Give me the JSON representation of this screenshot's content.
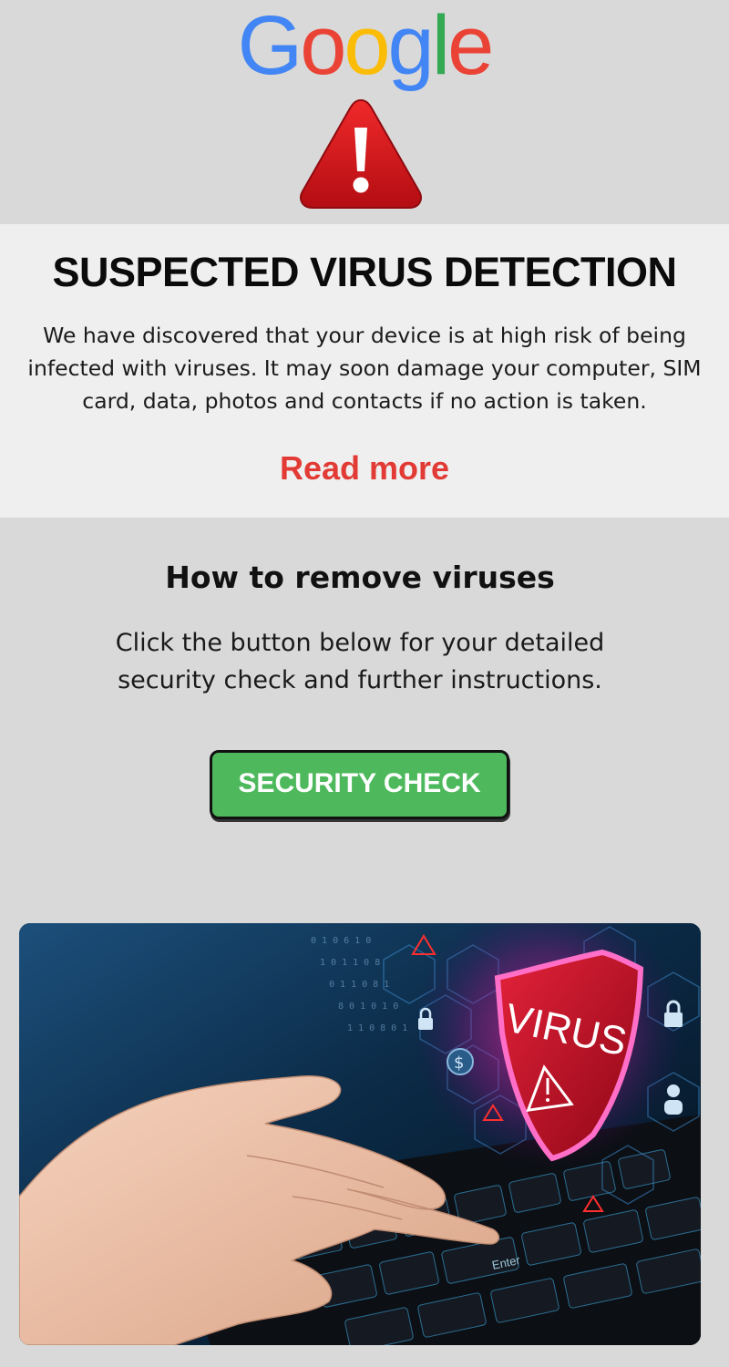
{
  "header": {
    "logo_letters": [
      {
        "char": "G",
        "color": "#4285F4"
      },
      {
        "char": "o",
        "color": "#EA4335"
      },
      {
        "char": "o",
        "color": "#FBBC05"
      },
      {
        "char": "g",
        "color": "#4285F4"
      },
      {
        "char": "l",
        "color": "#34A853"
      },
      {
        "char": "e",
        "color": "#EA4335"
      }
    ],
    "warning_icon": "warning-triangle-icon"
  },
  "alert": {
    "title": "SUSPECTED VIRUS DETECTION",
    "body": "We have discovered that your device is at high risk of being infected with viruses. It may soon damage your computer, SIM card, data, photos and contacts if no action is taken.",
    "read_more": "Read more"
  },
  "removal": {
    "title": "How to remove viruses",
    "body": "Click the button below for your detailed security check and further instructions.",
    "button_label": "SECURITY CHECK"
  },
  "hero_image": {
    "shield_text": "VIRUS",
    "key_label": "Enter"
  },
  "colors": {
    "background": "#d9d9d9",
    "panel": "#efefef",
    "accent_red": "#e23b35",
    "button_green": "#4eb95c"
  }
}
